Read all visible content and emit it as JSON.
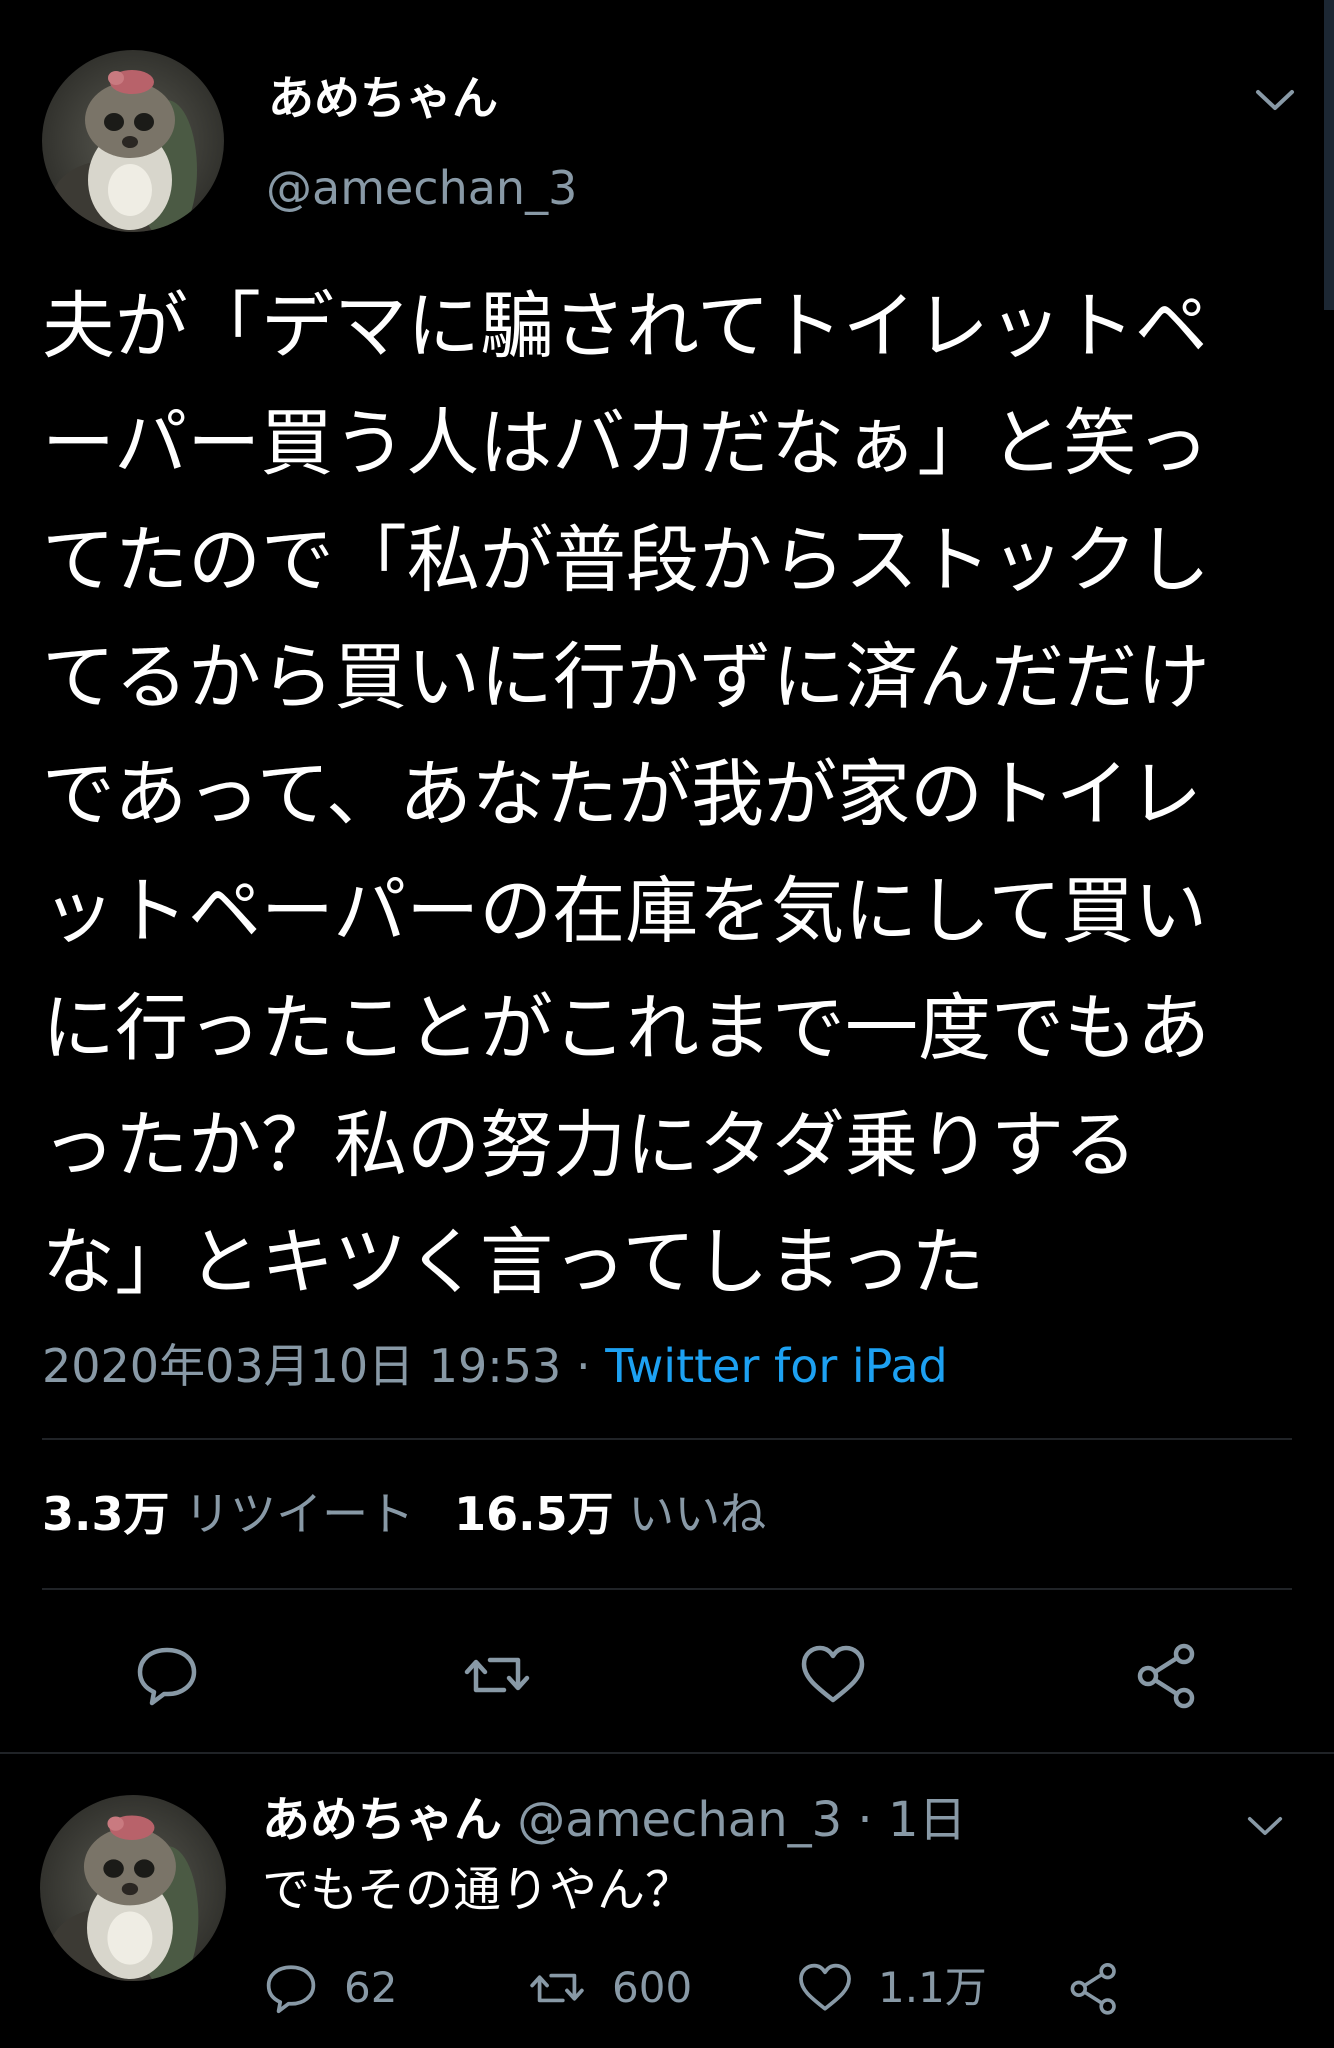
{
  "colors": {
    "background": "#000000",
    "text": "#ffffff",
    "secondary_text": "#8899a6",
    "link": "#1da1f2",
    "divider": "#202327"
  },
  "main_tweet": {
    "display_name": "あめちゃん",
    "handle": "@amechan_3",
    "text_lines": [
      "夫が「デマに騙されてトイレットペ",
      "ーパー買う人はバカだなぁ」と笑っ",
      "てたので「私が普段からストックし",
      "てるから買いに行かずに済んだだけ",
      "であって、あなたが我が家のトイレ",
      "ットペーパーの在庫を気にして買い",
      "に行ったことがこれまで一度でもあ",
      "ったか？私の努力にタダ乗りする",
      "な」とキツく言ってしまった"
    ],
    "timestamp": "2020年03月10日 19:53",
    "separator": " · ",
    "source": "Twitter for iPad",
    "retweets_count": "3.3万",
    "retweets_label": "リツイート",
    "likes_count": "16.5万",
    "likes_label": "いいね",
    "actions": {
      "reply_icon": "reply-icon",
      "retweet_icon": "retweet-icon",
      "like_icon": "heart-icon",
      "share_icon": "share-icon"
    }
  },
  "reply_tweet": {
    "display_name": "あめちゃん",
    "handle_time": " @amechan_3 · 1日",
    "text": "でもその通りやん？",
    "reply_count": "62",
    "retweet_count": "600",
    "like_count": "1.1万"
  }
}
